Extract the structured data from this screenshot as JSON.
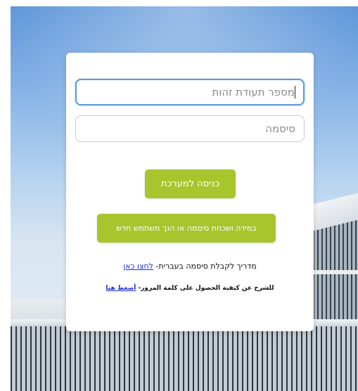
{
  "login": {
    "id_placeholder": "מספר תעודת זהות",
    "password_placeholder": "סיסמה",
    "login_button": "כניסה למערכת",
    "new_user_button": "במידה ושכחת סיסמה או הנך משתמש חדש",
    "guide_hebrew_text": "מדריך לקבלת סיסמה בעברית-",
    "guide_hebrew_link": "לחצו כאן",
    "guide_arabic_text": "للشرح عن كيفية الحصول على كلمة المرور-",
    "guide_arabic_link": "أضغط هنا"
  },
  "colors": {
    "button_green": "#a8c52d",
    "link_blue": "#1a2fd6",
    "focus_blue": "#5b9bd5"
  }
}
